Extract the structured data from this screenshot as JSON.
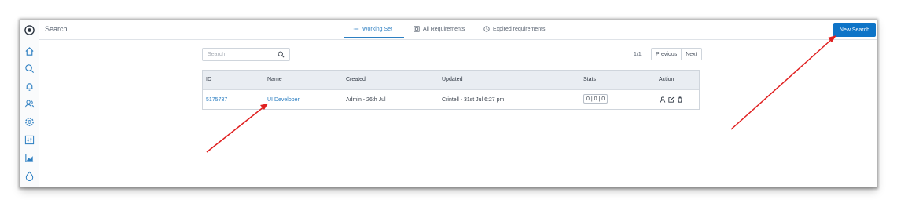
{
  "header": {
    "title": "Search",
    "tabs": [
      {
        "label": "Working Set",
        "icon": "list-icon",
        "active": true
      },
      {
        "label": "All Requirements",
        "icon": "grid-icon",
        "active": false
      },
      {
        "label": "Expired requirements",
        "icon": "clock-icon",
        "active": false
      }
    ],
    "new_search_label": "New Search"
  },
  "sidebar": {
    "icons": [
      "logo-icon",
      "home-icon",
      "search-icon",
      "bell-icon",
      "users-icon",
      "settings-icon",
      "sliders-icon",
      "chart-icon",
      "drop-icon"
    ]
  },
  "search": {
    "placeholder": "Search"
  },
  "pagination": {
    "page": "1/1",
    "prev_label": "Previous",
    "next_label": "Next"
  },
  "table": {
    "columns": [
      "ID",
      "Name",
      "Created",
      "Updated",
      "Stats",
      "Action"
    ],
    "rows": [
      {
        "id": "5175737",
        "name": "UI Developer",
        "created": "Admin - 26th Jul",
        "updated": "Crintell - 31st Jul 6:27 pm",
        "stats": "0 | 0 | 0",
        "actions": [
          "user-icon",
          "edit-icon",
          "trash-icon"
        ]
      }
    ]
  },
  "colors": {
    "accent": "#2d7fc2",
    "primary_button": "#0e74c7",
    "annotation_arrow": "#e02020"
  }
}
